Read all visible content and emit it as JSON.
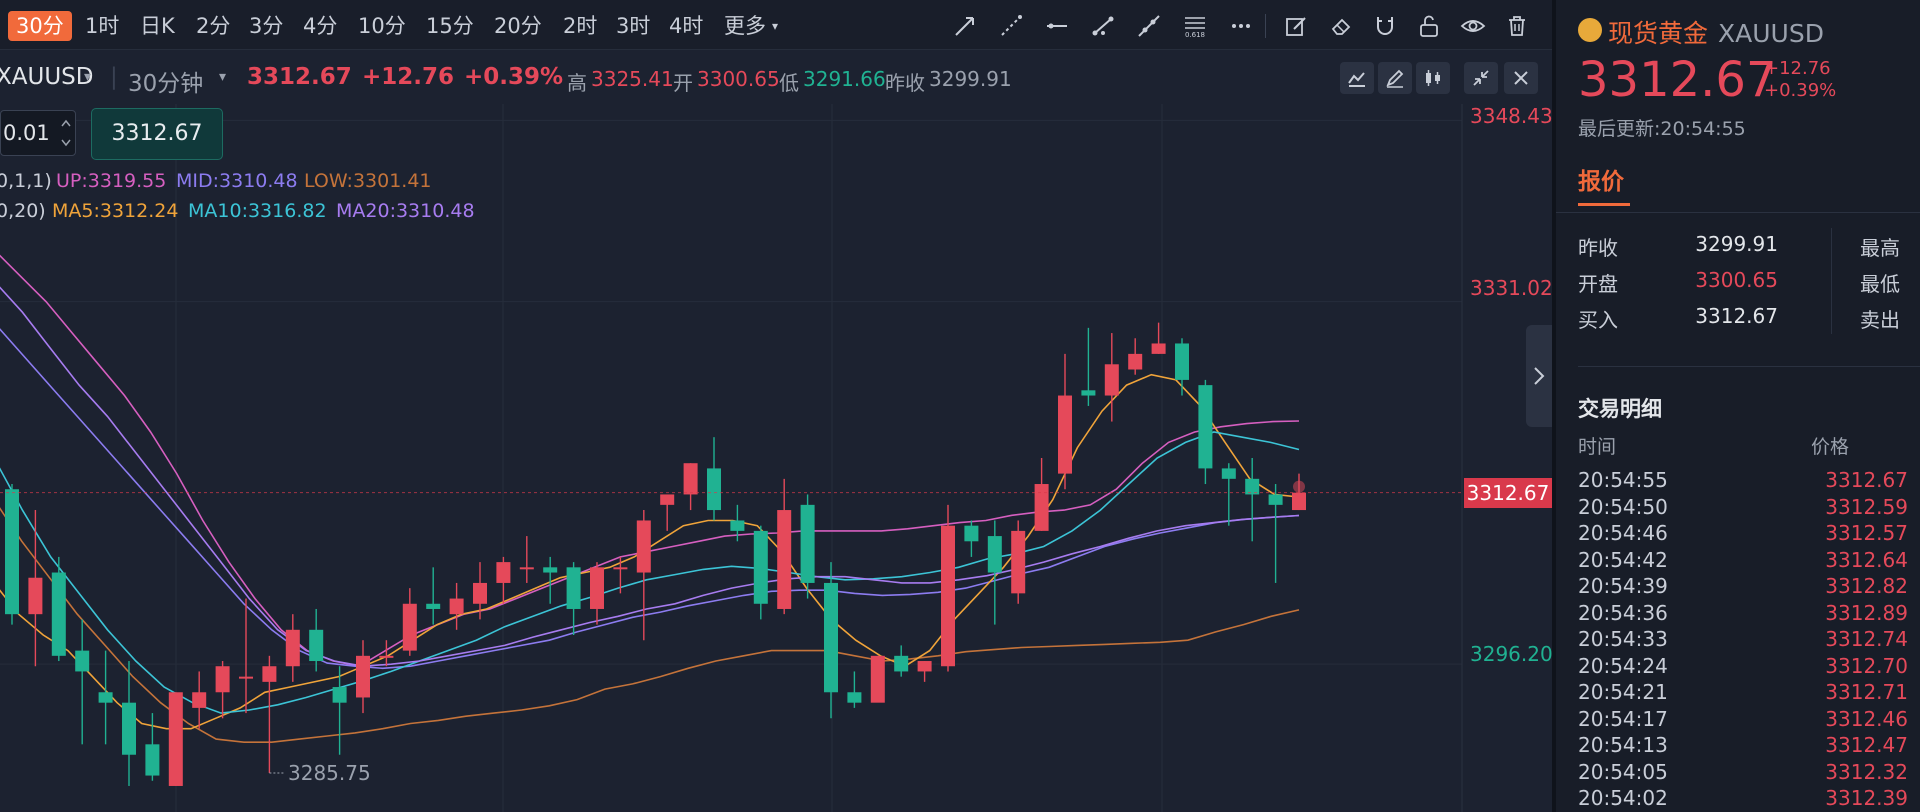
{
  "periods": [
    "30分",
    "1时",
    "日K",
    "2分",
    "3分",
    "4分",
    "10分",
    "15分",
    "20分",
    "2时",
    "3时",
    "4时",
    "更多"
  ],
  "active_period": "30分",
  "tools": [
    "arrow-line-icon",
    "dashed-ray-icon",
    "horizontal-line-icon",
    "trend-line-icon",
    "extended-line-icon",
    "fibonacci-icon",
    "more-dots-icon",
    "edit-icon",
    "eraser-icon",
    "magnet-icon",
    "unlock-icon",
    "eye-icon",
    "trash-icon"
  ],
  "fib_label": "0.618",
  "info": {
    "symbol": "XAUUSD",
    "interval": "30分钟",
    "price": "3312.67",
    "change": "+12.76",
    "change_pct": "+0.39%",
    "high_label": "高",
    "high": "3325.41",
    "open_label": "开",
    "open": "3300.65",
    "low_label": "低",
    "low": "3291.66",
    "prev_label": "昨收",
    "prev": "3299.91"
  },
  "order": {
    "qty": "0.01",
    "price": "3312.67"
  },
  "legend": {
    "boll_params": "0,1,1)",
    "up": "UP:3319.55",
    "mid": "MID:3310.48",
    "low": "LOW:3301.41",
    "ma_params": "0,20)",
    "ma5": "MA5:3312.24",
    "ma10": "MA10:3316.82",
    "ma20": "MA20:3310.48"
  },
  "y_axis": {
    "p1": "3348.43",
    "p2": "3331.02",
    "p3": "3296.20",
    "current": "3312.67"
  },
  "low_marker": "3285.75",
  "colors": {
    "up": "#e5495a",
    "down": "#20b292",
    "accent": "#f16a3b",
    "boll_up": "#d65fc0",
    "boll_mid": "#8c7cf0",
    "boll_low": "#c4733a",
    "ma5": "#f0a43a",
    "ma10": "#3cc4d6",
    "ma20": "#a77cf0"
  },
  "chart_data": {
    "type": "candlestick",
    "title": "XAUUSD 30分钟",
    "y_axis_labels": [
      3348.43,
      3331.02,
      3296.2
    ],
    "ylim": [
      3282,
      3350
    ],
    "candles": [
      {
        "o": 3313.0,
        "h": 3313.5,
        "l": 3300.0,
        "c": 3301.0
      },
      {
        "o": 3301.0,
        "h": 3311.0,
        "l": 3296.0,
        "c": 3304.5
      },
      {
        "o": 3305.0,
        "h": 3306.5,
        "l": 3296.5,
        "c": 3297.0
      },
      {
        "o": 3297.5,
        "h": 3300.5,
        "l": 3288.5,
        "c": 3295.5
      },
      {
        "o": 3293.5,
        "h": 3297.5,
        "l": 3288.5,
        "c": 3292.5
      },
      {
        "o": 3292.5,
        "h": 3296.5,
        "l": 3284.5,
        "c": 3287.5
      },
      {
        "o": 3288.5,
        "h": 3291.5,
        "l": 3285.0,
        "c": 3285.5
      },
      {
        "o": 3284.5,
        "h": 3293.5,
        "l": 3284.5,
        "c": 3293.5
      },
      {
        "o": 3292.0,
        "h": 3295.5,
        "l": 3290.0,
        "c": 3293.5
      },
      {
        "o": 3293.5,
        "h": 3296.5,
        "l": 3291.0,
        "c": 3296.0
      },
      {
        "o": 3295.0,
        "h": 3302.5,
        "l": 3291.5,
        "c": 3295.0
      },
      {
        "o": 3294.5,
        "h": 3297.0,
        "l": 3285.75,
        "c": 3296.0
      },
      {
        "o": 3296.0,
        "h": 3301.0,
        "l": 3294.5,
        "c": 3299.5
      },
      {
        "o": 3299.5,
        "h": 3301.5,
        "l": 3295.5,
        "c": 3296.5
      },
      {
        "o": 3294.0,
        "h": 3296.0,
        "l": 3287.5,
        "c": 3292.5
      },
      {
        "o": 3293.0,
        "h": 3298.5,
        "l": 3291.5,
        "c": 3297.0
      },
      {
        "o": 3297.0,
        "h": 3298.5,
        "l": 3296.0,
        "c": 3297.0
      },
      {
        "o": 3297.5,
        "h": 3303.5,
        "l": 3297.0,
        "c": 3302.0
      },
      {
        "o": 3302.0,
        "h": 3305.5,
        "l": 3300.0,
        "c": 3301.5
      },
      {
        "o": 3301.0,
        "h": 3304.0,
        "l": 3299.5,
        "c": 3302.5
      },
      {
        "o": 3302.0,
        "h": 3306.0,
        "l": 3300.5,
        "c": 3304.0
      },
      {
        "o": 3304.0,
        "h": 3306.5,
        "l": 3302.0,
        "c": 3306.0
      },
      {
        "o": 3305.5,
        "h": 3308.5,
        "l": 3304.0,
        "c": 3305.5
      },
      {
        "o": 3305.5,
        "h": 3306.5,
        "l": 3302.0,
        "c": 3305.0
      },
      {
        "o": 3305.5,
        "h": 3306.0,
        "l": 3299.0,
        "c": 3301.5
      },
      {
        "o": 3301.5,
        "h": 3306.0,
        "l": 3300.0,
        "c": 3305.5
      },
      {
        "o": 3305.5,
        "h": 3306.5,
        "l": 3303.0,
        "c": 3305.5
      },
      {
        "o": 3305.0,
        "h": 3311.0,
        "l": 3298.5,
        "c": 3310.0
      },
      {
        "o": 3311.5,
        "h": 3312.0,
        "l": 3309.0,
        "c": 3312.5
      },
      {
        "o": 3312.5,
        "h": 3315.5,
        "l": 3311.0,
        "c": 3315.5
      },
      {
        "o": 3315.0,
        "h": 3318.0,
        "l": 3310.0,
        "c": 3311.0
      },
      {
        "o": 3310.0,
        "h": 3311.5,
        "l": 3308.0,
        "c": 3309.0
      },
      {
        "o": 3309.0,
        "h": 3309.5,
        "l": 3300.5,
        "c": 3302.0
      },
      {
        "o": 3301.5,
        "h": 3314.0,
        "l": 3301.0,
        "c": 3311.0
      },
      {
        "o": 3311.5,
        "h": 3312.5,
        "l": 3302.5,
        "c": 3304.0
      },
      {
        "o": 3304.0,
        "h": 3306.0,
        "l": 3291.0,
        "c": 3293.5
      },
      {
        "o": 3293.5,
        "h": 3295.5,
        "l": 3292.0,
        "c": 3292.5
      },
      {
        "o": 3292.5,
        "h": 3297.0,
        "l": 3293.0,
        "c": 3297.0
      },
      {
        "o": 3297.0,
        "h": 3298.0,
        "l": 3295.0,
        "c": 3295.5
      },
      {
        "o": 3295.5,
        "h": 3296.5,
        "l": 3294.5,
        "c": 3296.5
      },
      {
        "o": 3296.0,
        "h": 3311.5,
        "l": 3295.5,
        "c": 3309.5
      },
      {
        "o": 3309.5,
        "h": 3310.0,
        "l": 3306.5,
        "c": 3308.0
      },
      {
        "o": 3308.5,
        "h": 3310.0,
        "l": 3300.0,
        "c": 3305.0
      },
      {
        "o": 3303.0,
        "h": 3310.0,
        "l": 3302.0,
        "c": 3309.0
      },
      {
        "o": 3309.0,
        "h": 3316.0,
        "l": 3309.0,
        "c": 3313.5
      },
      {
        "o": 3314.5,
        "h": 3326.0,
        "l": 3313.0,
        "c": 3322.0
      },
      {
        "o": 3322.5,
        "h": 3328.5,
        "l": 3321.0,
        "c": 3322.0
      },
      {
        "o": 3322.0,
        "h": 3328.0,
        "l": 3319.5,
        "c": 3325.0
      },
      {
        "o": 3324.5,
        "h": 3327.5,
        "l": 3324.0,
        "c": 3326.0
      },
      {
        "o": 3326.0,
        "h": 3329.0,
        "l": 3326.0,
        "c": 3327.0
      },
      {
        "o": 3327.0,
        "h": 3327.5,
        "l": 3322.0,
        "c": 3323.5
      },
      {
        "o": 3323.0,
        "h": 3323.5,
        "l": 3313.5,
        "c": 3315.0
      },
      {
        "o": 3315.0,
        "h": 3315.5,
        "l": 3309.5,
        "c": 3314.0
      },
      {
        "o": 3314.0,
        "h": 3316.0,
        "l": 3308.0,
        "c": 3312.5
      },
      {
        "o": 3312.5,
        "h": 3313.5,
        "l": 3304.0,
        "c": 3311.5
      },
      {
        "o": 3311.0,
        "h": 3314.5,
        "l": 3311.0,
        "c": 3312.67
      }
    ],
    "series": [
      {
        "name": "UP",
        "values": [
          3336.0,
          3333.5,
          3331.0,
          3328.0,
          3325.0,
          3322.0,
          3318.5,
          3314.5,
          3310.0,
          3306.0,
          3302.5,
          3299.5,
          3297.5,
          3296.5,
          3296.0,
          3297.5,
          3299.0,
          3300.0,
          3301.0,
          3301.5,
          3302.5,
          3303.5,
          3304.5,
          3305.5,
          3306.5,
          3307.0,
          3307.5,
          3308.0,
          3308.5,
          3308.7,
          3308.8,
          3309.0,
          3309.0,
          3309.0,
          3309.0,
          3309.2,
          3309.5,
          3309.8,
          3310.0,
          3310.5,
          3310.8,
          3311.0,
          3311.5,
          3313.0,
          3315.5,
          3317.5,
          3318.5,
          3319.0,
          3319.3,
          3319.5,
          3319.55
        ]
      },
      {
        "name": "MID",
        "values": [
          3329.0,
          3326.0,
          3323.0,
          3320.0,
          3317.0,
          3314.0,
          3311.0,
          3308.0,
          3305.0,
          3302.0,
          3299.5,
          3297.5,
          3296.3,
          3296.0,
          3295.8,
          3296.0,
          3296.5,
          3297.0,
          3297.5,
          3298.0,
          3298.5,
          3299.3,
          3300.0,
          3300.7,
          3301.2,
          3301.8,
          3302.3,
          3302.8,
          3303.2,
          3303.3,
          3303.3,
          3303.0,
          3302.8,
          3302.9,
          3303.1,
          3303.5,
          3304.2,
          3304.9,
          3305.5,
          3306.5,
          3307.5,
          3308.2,
          3308.8,
          3309.3,
          3309.8,
          3310.1,
          3310.3,
          3310.48
        ]
      },
      {
        "name": "LOW",
        "values": [
          3312.0,
          3308.0,
          3304.5,
          3301.0,
          3298.0,
          3295.0,
          3292.5,
          3290.5,
          3289.0,
          3288.7,
          3288.7,
          3289.0,
          3289.3,
          3289.6,
          3290.0,
          3290.5,
          3290.8,
          3291.2,
          3291.5,
          3291.8,
          3292.2,
          3292.8,
          3293.8,
          3294.3,
          3295.0,
          3295.8,
          3296.5,
          3297.0,
          3297.5,
          3297.5,
          3297.5,
          3297.0,
          3296.5,
          3296.7,
          3297.0,
          3297.4,
          3297.6,
          3297.8,
          3297.9,
          3298.0,
          3298.1,
          3298.2,
          3298.3,
          3298.5,
          3299.3,
          3300.0,
          3300.8,
          3301.41
        ]
      },
      {
        "name": "MA5",
        "values": [
          3304.0,
          3301.0,
          3299.0,
          3297.5,
          3295.0,
          3292.5,
          3290.5,
          3290.0,
          3290.0,
          3291.0,
          3292.0,
          3293.5,
          3294.0,
          3294.5,
          3295.0,
          3296.0,
          3297.0,
          3298.5,
          3300.0,
          3301.0,
          3301.5,
          3302.5,
          3303.5,
          3304.5,
          3305.0,
          3305.5,
          3306.5,
          3308.0,
          3309.5,
          3310.0,
          3310.0,
          3309.5,
          3307.0,
          3303.5,
          3300.5,
          3298.5,
          3297.0,
          3296.0,
          3297.5,
          3300.5,
          3303.0,
          3305.5,
          3308.5,
          3312.0,
          3317.0,
          3320.5,
          3323.0,
          3324.0,
          3323.5,
          3321.0,
          3317.5,
          3314.0,
          3312.5,
          3312.24
        ]
      },
      {
        "name": "MA10",
        "values": [
          3316.0,
          3311.0,
          3306.5,
          3303.0,
          3299.5,
          3296.5,
          3294.0,
          3292.5,
          3291.5,
          3291.8,
          3292.3,
          3293.0,
          3293.8,
          3294.6,
          3295.5,
          3296.5,
          3297.5,
          3298.5,
          3299.8,
          3300.8,
          3301.8,
          3302.6,
          3303.5,
          3304.3,
          3304.8,
          3305.3,
          3305.6,
          3305.4,
          3305.0,
          3304.6,
          3304.3,
          3304.4,
          3304.6,
          3305.0,
          3305.5,
          3306.3,
          3306.8,
          3307.5,
          3309.0,
          3311.0,
          3313.5,
          3316.0,
          3317.5,
          3318.5,
          3318.0,
          3317.5,
          3316.82
        ]
      },
      {
        "name": "MA20",
        "values": [
          3333.0,
          3330.0,
          3326.5,
          3323.0,
          3320.0,
          3316.5,
          3313.0,
          3309.5,
          3306.0,
          3302.5,
          3299.5,
          3297.5,
          3296.5,
          3296.0,
          3296.2,
          3296.5,
          3297.0,
          3297.5,
          3298.0,
          3298.8,
          3299.5,
          3300.2,
          3300.8,
          3301.5,
          3302.0,
          3302.8,
          3303.5,
          3304.0,
          3304.4,
          3304.6,
          3304.6,
          3304.3,
          3304.0,
          3304.0,
          3304.3,
          3304.7,
          3305.3,
          3306.0,
          3306.8,
          3307.5,
          3308.3,
          3309.0,
          3309.5,
          3309.8,
          3310.1,
          3310.3,
          3310.48
        ]
      }
    ]
  },
  "right_panel": {
    "name": "现货黄金",
    "code": "XAUUSD",
    "price": "3312.67",
    "change": "+12.76",
    "change_pct": "+0.39%",
    "update_label": "最后更新:",
    "update_time": "20:54:55",
    "tab": "报价",
    "quotes": [
      {
        "k": "昨收",
        "v": "3299.91",
        "color": "#e3e6ea",
        "k2": "最高"
      },
      {
        "k": "开盘",
        "v": "3300.65",
        "color": "#e5495a",
        "k2": "最低"
      },
      {
        "k": "买入",
        "v": "3312.67",
        "color": "#e3e6ea",
        "k2": "卖出"
      }
    ],
    "trades_title": "交易明细",
    "col_time": "时间",
    "col_price": "价格",
    "trades": [
      {
        "t": "20:54:55",
        "p": "3312.67"
      },
      {
        "t": "20:54:50",
        "p": "3312.59"
      },
      {
        "t": "20:54:46",
        "p": "3312.57"
      },
      {
        "t": "20:54:42",
        "p": "3312.64"
      },
      {
        "t": "20:54:39",
        "p": "3312.82"
      },
      {
        "t": "20:54:36",
        "p": "3312.89"
      },
      {
        "t": "20:54:33",
        "p": "3312.74"
      },
      {
        "t": "20:54:24",
        "p": "3312.70"
      },
      {
        "t": "20:54:21",
        "p": "3312.71"
      },
      {
        "t": "20:54:17",
        "p": "3312.46"
      },
      {
        "t": "20:54:13",
        "p": "3312.47"
      },
      {
        "t": "20:54:05",
        "p": "3312.32"
      },
      {
        "t": "20:54:02",
        "p": "3312.39"
      }
    ]
  }
}
